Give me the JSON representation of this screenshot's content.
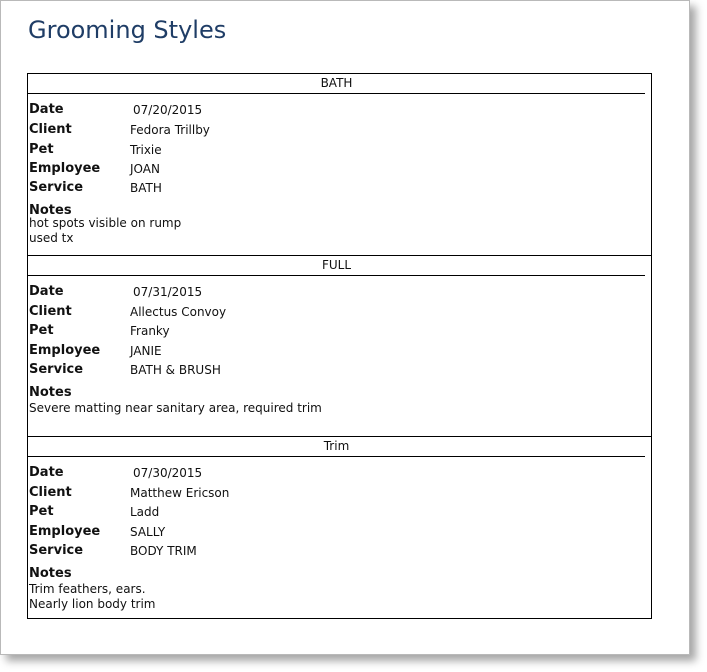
{
  "page": {
    "title": "Grooming Styles"
  },
  "labels": {
    "date": "Date",
    "client": "Client",
    "pet": "Pet",
    "employee": "Employee",
    "service": "Service",
    "notes": "Notes"
  },
  "groups": [
    {
      "header": "BATH",
      "date": "07/20/2015",
      "client": "Fedora Trillby",
      "pet": "Trixie",
      "employee": "JOAN",
      "service": "BATH",
      "notes_line1": "hot spots visible on rump",
      "notes_line2": "used tx"
    },
    {
      "header": "FULL",
      "date": "07/31/2015",
      "client": "Allectus Convoy",
      "pet": "Franky",
      "employee": "JANIE",
      "service": "BATH & BRUSH",
      "notes_line1": "Severe matting near sanitary area, required trim",
      "notes_line2": ""
    },
    {
      "header": "Trim",
      "date": "07/30/2015",
      "client": "Matthew Ericson",
      "pet": "Ladd",
      "employee": "SALLY",
      "service": "BODY TRIM",
      "notes_line1": "Trim feathers, ears.",
      "notes_line2": "Nearly lion body trim"
    }
  ]
}
